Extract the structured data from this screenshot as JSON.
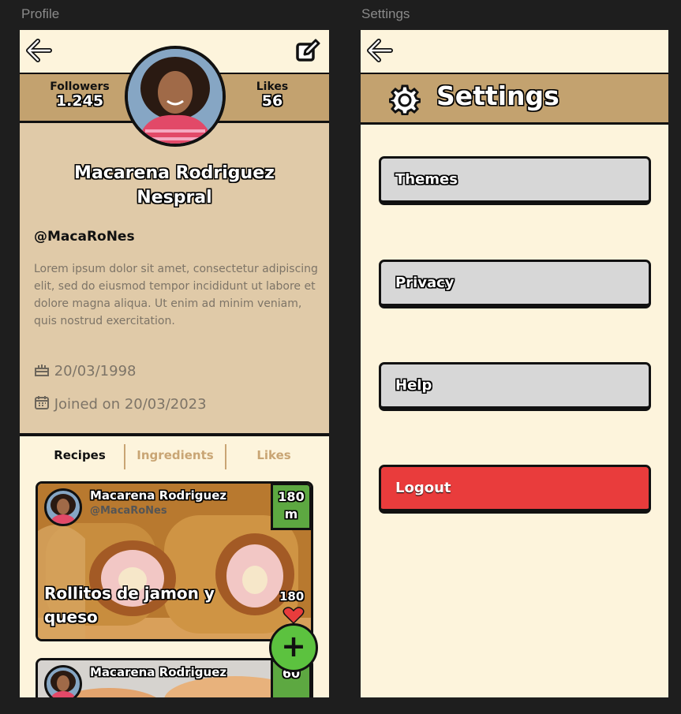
{
  "frames": {
    "profile_title": "Profile",
    "settings_title": "Settings"
  },
  "profile": {
    "followers_label": "Followers",
    "followers_value": "1.245",
    "likes_label": "Likes",
    "likes_value": "56",
    "name": "Macarena Rodriguez Nespral",
    "handle": "@MacaRoNes",
    "bio": "Lorem ipsum dolor sit amet, consectetur adipiscing elit, sed do eiusmod tempor incididunt ut labore et dolore magna aliqua. Ut enim ad minim veniam, quis nostrud exercitation.",
    "birthday": "20/03/1998",
    "joined": "Joined on 20/03/2023",
    "tabs": [
      {
        "label": "Recipes",
        "active": true
      },
      {
        "label": "Ingredients",
        "active": false
      },
      {
        "label": "Likes",
        "active": false
      }
    ],
    "recipes": [
      {
        "author": "Macarena Rodriguez",
        "handle": "@MacaRoNes",
        "minutes": "180",
        "minutes_unit": "m",
        "title": "Rollitos de jamon y queso",
        "likes": "180"
      },
      {
        "author": "Macarena Rodriguez",
        "minutes": "60"
      }
    ],
    "fab_label": "+"
  },
  "settings": {
    "title": "Settings",
    "buttons": [
      {
        "label": "Themes"
      },
      {
        "label": "Privacy"
      },
      {
        "label": "Help"
      },
      {
        "label": "Logout"
      }
    ]
  },
  "colors": {
    "page_bg": "#fdf4dc",
    "header_tan": "#c3a26f",
    "bio_tan": "#e0caa8",
    "button_gray": "#d7d7d7",
    "logout_red": "#e93c3c",
    "time_green": "#5da841",
    "fab_green": "#5cc23f",
    "tab_inactive": "#c9a574"
  },
  "icons": [
    "back-arrow-icon",
    "edit-icon",
    "cake-icon",
    "calendar-icon",
    "heart-icon",
    "gear-icon",
    "plus-icon"
  ]
}
